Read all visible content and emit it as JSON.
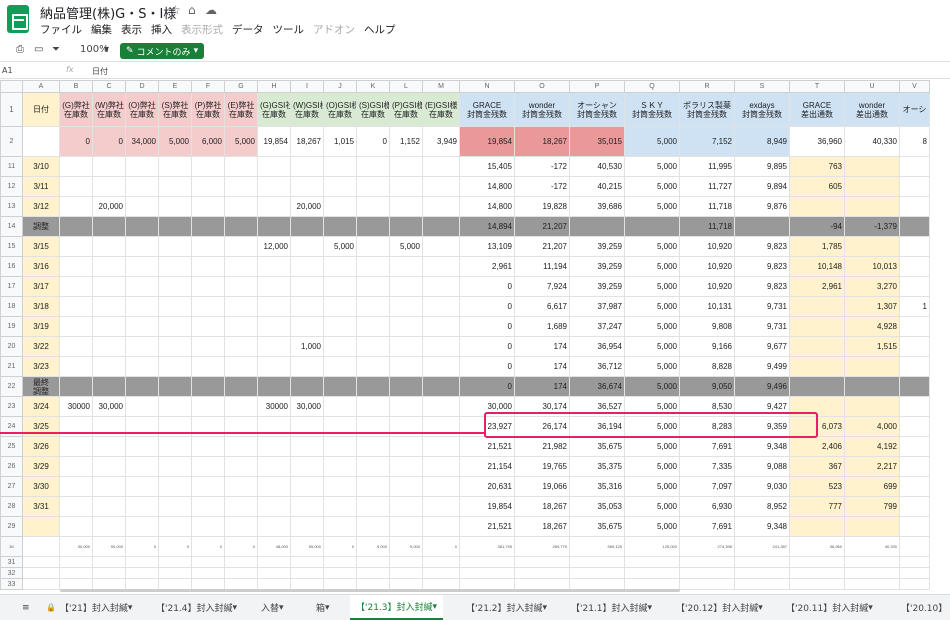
{
  "title": "納品管理(株)G・S・I様",
  "menu": [
    "ファイル",
    "編集",
    "表示",
    "挿入",
    "表示形式",
    "データ",
    "ツール",
    "アドオン",
    "ヘルプ"
  ],
  "toolbar": {
    "zoom": "100%",
    "comment_mode": "コメントのみ"
  },
  "formula": {
    "cell_ref": "A1",
    "fx": "fx",
    "value": "日付"
  },
  "columns": [
    "",
    "A",
    "B",
    "C",
    "D",
    "E",
    "F",
    "G",
    "H",
    "I",
    "J",
    "K",
    "L",
    "M",
    "N",
    "O",
    "P",
    "Q",
    "R",
    "S",
    "T",
    "U",
    "V"
  ],
  "header_row": {
    "num": "1",
    "cells": [
      "日付",
      "(G)弊社\n在庫数",
      "(W)弊社\n在庫数",
      "(O)弊社\n在庫数",
      "(S)弊社\n在庫数",
      "(P)弊社\n在庫数",
      "(E)弊社\n在庫数",
      "(G)GSI社\n在庫数",
      "(W)GSI様\n在庫数",
      "(O)GSI様\n在庫数",
      "(S)GSI様\n在庫数",
      "(P)GSI様\n在庫数",
      "(E)GSI様\n在庫数",
      "GRACE\n封筒金残数",
      "wonder\n封筒金残数",
      "オーシャン\n封筒金残数",
      "ＳＫＹ\n封筒金残数",
      "ポラリス製薬\n封筒金残数",
      "exdays\n封筒金残数",
      "GRACE\n差出通数",
      "wonder\n差出通数",
      "オーシ"
    ]
  },
  "row2": {
    "num": "2",
    "cells": [
      "",
      "0",
      "0",
      "34,000",
      "5,000",
      "6,000",
      "5,000",
      "19,854",
      "18,267",
      "1,015",
      "0",
      "1,152",
      "3,949",
      "19,854",
      "18,267",
      "35,015",
      "5,000",
      "7,152",
      "8,949",
      "36,960",
      "40,330",
      "8"
    ]
  },
  "rows": [
    {
      "num": "11",
      "cells": [
        "3/10",
        "",
        "",
        "",
        "",
        "",
        "",
        "",
        "",
        "",
        "",
        "",
        "",
        "15,405",
        "-172",
        "40,530",
        "5,000",
        "11,995",
        "9,895",
        "763",
        "",
        ""
      ]
    },
    {
      "num": "12",
      "cells": [
        "3/11",
        "",
        "",
        "",
        "",
        "",
        "",
        "",
        "",
        "",
        "",
        "",
        "",
        "14,800",
        "-172",
        "40,215",
        "5,000",
        "11,727",
        "9,894",
        "605",
        "",
        ""
      ]
    },
    {
      "num": "13",
      "cells": [
        "3/12",
        "",
        "20,000",
        "",
        "",
        "",
        "",
        "",
        "20,000",
        "",
        "",
        "",
        "",
        "14,800",
        "19,828",
        "39,686",
        "5,000",
        "11,718",
        "9,876",
        "",
        "",
        ""
      ]
    },
    {
      "num": "14",
      "gray": true,
      "cells": [
        "調整",
        "",
        "",
        "",
        "",
        "",
        "",
        "",
        "",
        "",
        "",
        "",
        "",
        "14,894",
        "21,207",
        "",
        "",
        "11,718",
        "",
        "-94",
        "-1,379",
        ""
      ]
    },
    {
      "num": "15",
      "cells": [
        "3/15",
        "",
        "",
        "",
        "",
        "",
        "",
        "12,000",
        "",
        "5,000",
        "",
        "5,000",
        "",
        "13,109",
        "21,207",
        "39,259",
        "5,000",
        "10,920",
        "9,823",
        "1,785",
        "",
        ""
      ]
    },
    {
      "num": "16",
      "cells": [
        "3/16",
        "",
        "",
        "",
        "",
        "",
        "",
        "",
        "",
        "",
        "",
        "",
        "",
        "2,961",
        "11,194",
        "39,259",
        "5,000",
        "10,920",
        "9,823",
        "10,148",
        "10,013",
        ""
      ]
    },
    {
      "num": "17",
      "cells": [
        "3/17",
        "",
        "",
        "",
        "",
        "",
        "",
        "",
        "",
        "",
        "",
        "",
        "",
        "0",
        "7,924",
        "39,259",
        "5,000",
        "10,920",
        "9,823",
        "2,961",
        "3,270",
        ""
      ]
    },
    {
      "num": "18",
      "cells": [
        "3/18",
        "",
        "",
        "",
        "",
        "",
        "",
        "",
        "",
        "",
        "",
        "",
        "",
        "0",
        "6,617",
        "37,987",
        "5,000",
        "10,131",
        "9,731",
        "",
        "1,307",
        "1"
      ]
    },
    {
      "num": "19",
      "cells": [
        "3/19",
        "",
        "",
        "",
        "",
        "",
        "",
        "",
        "",
        "",
        "",
        "",
        "",
        "0",
        "1,689",
        "37,247",
        "5,000",
        "9,808",
        "9,731",
        "",
        "4,928",
        ""
      ]
    },
    {
      "num": "20",
      "cells": [
        "3/22",
        "",
        "",
        "",
        "",
        "",
        "",
        "",
        "1,000",
        "",
        "",
        "",
        "",
        "0",
        "174",
        "36,954",
        "5,000",
        "9,166",
        "9,677",
        "",
        "1,515",
        ""
      ]
    },
    {
      "num": "21",
      "cells": [
        "3/23",
        "",
        "",
        "",
        "",
        "",
        "",
        "",
        "",
        "",
        "",
        "",
        "",
        "0",
        "174",
        "36,712",
        "5,000",
        "8,828",
        "9,499",
        "",
        "",
        ""
      ]
    },
    {
      "num": "22",
      "gray": true,
      "cells": [
        "最終\n調整",
        "",
        "",
        "",
        "",
        "",
        "",
        "",
        "",
        "",
        "",
        "",
        "",
        "0",
        "174",
        "36,674",
        "5,000",
        "9,050",
        "9,496",
        "",
        "",
        ""
      ]
    },
    {
      "num": "23",
      "cells": [
        "3/24",
        "30000",
        "30,000",
        "",
        "",
        "",
        "",
        "30000",
        "30,000",
        "",
        "",
        "",
        "",
        "30,000",
        "30,174",
        "36,527",
        "5,000",
        "8,530",
        "9,427",
        "",
        "",
        ""
      ]
    },
    {
      "num": "24",
      "cells": [
        "3/25",
        "",
        "",
        "",
        "",
        "",
        "",
        "",
        "",
        "",
        "",
        "",
        "",
        "23,927",
        "26,174",
        "36,194",
        "5,000",
        "8,283",
        "9,359",
        "6,073",
        "4,000",
        ""
      ]
    },
    {
      "num": "25",
      "cells": [
        "3/26",
        "",
        "",
        "",
        "",
        "",
        "",
        "",
        "",
        "",
        "",
        "",
        "",
        "21,521",
        "21,982",
        "35,675",
        "5,000",
        "7,691",
        "9,348",
        "2,406",
        "4,192",
        ""
      ]
    },
    {
      "num": "26",
      "cells": [
        "3/29",
        "",
        "",
        "",
        "",
        "",
        "",
        "",
        "",
        "",
        "",
        "",
        "",
        "21,154",
        "19,765",
        "35,375",
        "5,000",
        "7,335",
        "9,088",
        "367",
        "2,217",
        ""
      ]
    },
    {
      "num": "27",
      "cells": [
        "3/30",
        "",
        "",
        "",
        "",
        "",
        "",
        "",
        "",
        "",
        "",
        "",
        "",
        "20,631",
        "19,066",
        "35,316",
        "5,000",
        "7,097",
        "9,030",
        "523",
        "699",
        ""
      ]
    },
    {
      "num": "28",
      "cells": [
        "3/31",
        "",
        "",
        "",
        "",
        "",
        "",
        "",
        "",
        "",
        "",
        "",
        "",
        "19,854",
        "18,267",
        "35,053",
        "5,000",
        "6,930",
        "8,952",
        "777",
        "799",
        ""
      ]
    },
    {
      "num": "29",
      "cells": [
        "",
        "",
        "",
        "",
        "",
        "",
        "",
        "",
        "",
        "",
        "",
        "",
        "",
        "21,521",
        "18,267",
        "35,675",
        "5,000",
        "7,691",
        "9,348",
        "",
        "",
        ""
      ]
    }
  ],
  "sum_row": {
    "num": "30",
    "cells": [
      "",
      "30,000",
      "50,000",
      "0",
      "0",
      "0",
      "0",
      "48,000",
      "55,000",
      "0",
      "5,000",
      "5,000",
      "0",
      "381,795",
      "269,779",
      "969,125",
      "125,000",
      "274,396",
      "241,387",
      "36,960",
      "40,330",
      ""
    ]
  },
  "empty_rows": [
    "31",
    "32",
    "33"
  ],
  "sheets": [
    "【'21】封入封緘",
    "【'21.4】封入封緘",
    "入替",
    "箱",
    "【'21.3】封入封緘",
    "【'21.2】封入封緘",
    "【'21.1】封入封緘",
    "【'20.12】封入封緘",
    "【'20.11】封入封緘",
    "【'20.10】"
  ],
  "active_sheet_index": 4
}
